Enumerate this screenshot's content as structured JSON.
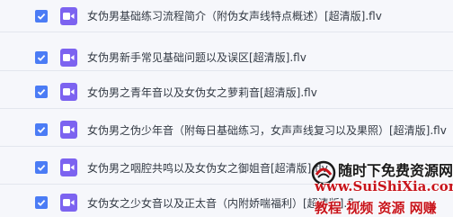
{
  "files": [
    {
      "name": "女伪男基础练习流程简介（附伪女声线特点概述）[超清版].flv",
      "checked": true
    },
    {
      "name": "女伪男新手常见基础问题以及误区[超清版].flv",
      "checked": true
    },
    {
      "name": "女伪男之青年音以及女伪女之萝莉音[超清版].flv",
      "checked": true
    },
    {
      "name": "女伪男之伪少年音（附每日基础练习，女声声线复习以及果照）[超清版].flv",
      "checked": true
    },
    {
      "name": "女伪男之咽腔共鸣以及女伪女之御姐音[超清版].flv",
      "checked": true
    },
    {
      "name": "女伪女之少女音以及正太音（内附娇喘福利）[超清版].flv",
      "checked": true
    }
  ],
  "watermark": {
    "line1": "随时下免费资源网",
    "line2": "www.SuiShiXia.com",
    "line3": "教程 视频 资源 网赚"
  },
  "colors": {
    "checkbox": "#4b7cf5",
    "video_icon": "#7c63f0",
    "text": "#333a44",
    "watermark_red": "#c8141b"
  },
  "icons": {
    "checkbox": "checkmark-icon",
    "file": "video-file-icon"
  }
}
